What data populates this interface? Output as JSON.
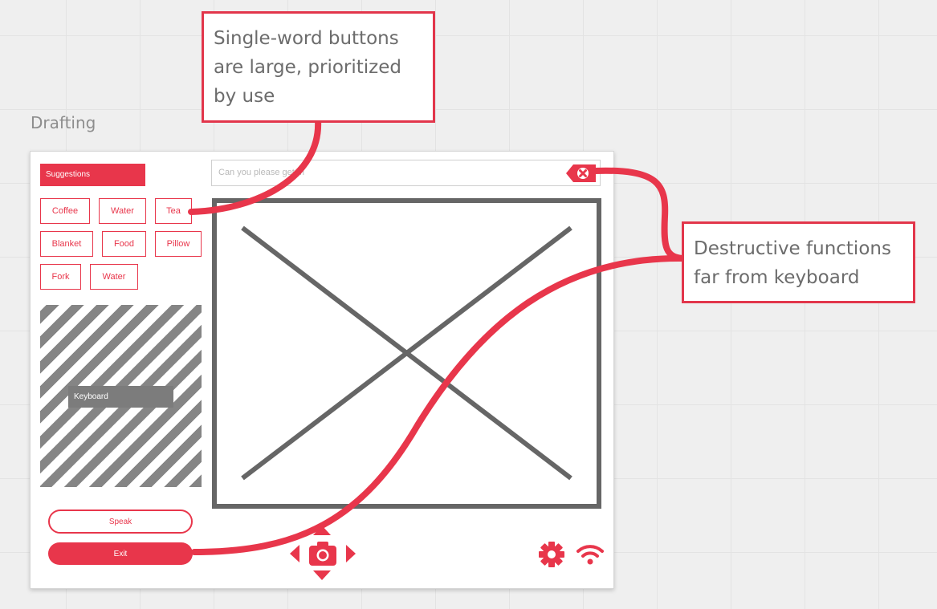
{
  "frame_label": "Drafting",
  "suggestions": {
    "header": "Suggestions",
    "chips": [
      "Coffee",
      "Water",
      "Tea",
      "Blanket",
      "Food",
      "Pillow",
      "Fork",
      "Water"
    ]
  },
  "keyboard": {
    "label": "Keyboard"
  },
  "buttons": {
    "speak": "Speak",
    "exit": "Exit"
  },
  "input": {
    "placeholder": "Can you please get m"
  },
  "annotations": [
    {
      "lines": [
        "Single-word buttons",
        "are large, prioritized",
        "by use"
      ]
    },
    {
      "lines": [
        "Destructive functions",
        "far from keyboard"
      ]
    }
  ],
  "colors": {
    "accent": "#e8364b",
    "placeholder_stroke": "#666666",
    "keyboard_stripe": "#858585"
  },
  "icons": [
    "clear-icon",
    "arrow-up-icon",
    "arrow-down-icon",
    "arrow-left-icon",
    "arrow-right-icon",
    "camera-icon",
    "gear-icon",
    "wifi-icon"
  ]
}
